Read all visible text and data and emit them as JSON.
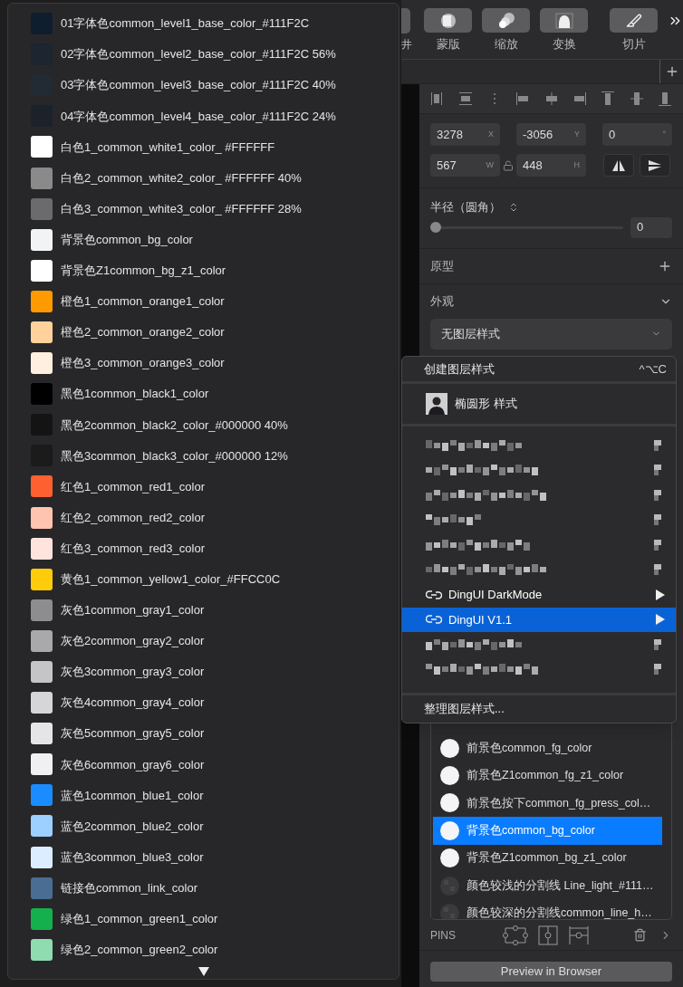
{
  "color_list": {
    "items": [
      {
        "label": "01字体色common_level1_base_color_#111F2C",
        "color": "#0f1e2e"
      },
      {
        "label": "02字体色common_level2_base_color_#111F2C 56%",
        "color": "#1c2530"
      },
      {
        "label": "03字体色common_level3_base_color_#111F2C 40%",
        "color": "#222a33"
      },
      {
        "label": "04字体色common_level4_base_color_#111F2C 24%",
        "color": "#1c222a"
      },
      {
        "label": "白色1_common_white1_color_ #FFFFFF",
        "color": "#ffffff"
      },
      {
        "label": "白色2_common_white2_color_ #FFFFFF 40%",
        "color": "#8a8a8a"
      },
      {
        "label": "白色3_common_white3_color_ #FFFFFF 28%",
        "color": "#6b6b6d"
      },
      {
        "label": "背景色common_bg_color",
        "color": "#f2f3f5"
      },
      {
        "label": "背景色Z1common_bg_z1_color",
        "color": "#ffffff"
      },
      {
        "label": "橙色1_common_orange1_color",
        "color": "#ff9a00"
      },
      {
        "label": "橙色2_common_orange2_color",
        "color": "#ffd29b"
      },
      {
        "label": "橙色3_common_orange3_color",
        "color": "#ffefe0"
      },
      {
        "label": "黑色1common_black1_color",
        "color": "#000000"
      },
      {
        "label": "黑色2common_black2_color_#000000 40%",
        "color": "#141414"
      },
      {
        "label": "黑色3common_black3_color_#000000 12%",
        "color": "#1b1b1c"
      },
      {
        "label": "红色1_common_red1_color",
        "color": "#ff6030"
      },
      {
        "label": "红色2_common_red2_color",
        "color": "#ffc4b0"
      },
      {
        "label": "红色3_common_red3_color",
        "color": "#ffe4dd"
      },
      {
        "label": "黄色1_common_yellow1_color_#FFCC0C",
        "color": "#ffcc0c"
      },
      {
        "label": "灰色1common_gray1_color",
        "color": "#8d8d90"
      },
      {
        "label": "灰色2common_gray2_color",
        "color": "#a9a9ac"
      },
      {
        "label": "灰色3common_gray3_color",
        "color": "#c5c5c8"
      },
      {
        "label": "灰色4common_gray4_color",
        "color": "#d6d6d8"
      },
      {
        "label": "灰色5common_gray5_color",
        "color": "#e5e5e7"
      },
      {
        "label": "灰色6common_gray6_color",
        "color": "#f0f0f2"
      },
      {
        "label": "蓝色1common_blue1_color",
        "color": "#1a8cff"
      },
      {
        "label": "蓝色2common_blue2_color",
        "color": "#9dcfff"
      },
      {
        "label": "蓝色3common_blue3_color",
        "color": "#dcedff"
      },
      {
        "label": "链接色common_link_color",
        "color": "#4a6d93"
      },
      {
        "label": "绿色1_common_green1_color",
        "color": "#14b04e"
      },
      {
        "label": "绿色2_common_green2_color",
        "color": "#8fdcb0"
      }
    ]
  },
  "toolbar": {
    "buttons": [
      {
        "label": "井",
        "kind": "cut"
      },
      {
        "label": "蒙版",
        "kind": "mask"
      },
      {
        "label": "缩放",
        "kind": "scale"
      },
      {
        "label": "变换",
        "kind": "transform"
      },
      {
        "label": "切片",
        "kind": "slice"
      }
    ]
  },
  "inspector": {
    "position": [
      {
        "value": "3278",
        "unit": "X"
      },
      {
        "value": "-3056",
        "unit": "Y"
      },
      {
        "value": "0",
        "unit": "°"
      }
    ],
    "size": [
      {
        "value": "567",
        "unit": "W"
      },
      {
        "value": "448",
        "unit": "H"
      }
    ],
    "locked": false,
    "radius": {
      "label": "半径（圆角）",
      "level": 0,
      "value": "0"
    },
    "prototype": "原型",
    "appearance": "外观",
    "style_select": "无图层样式"
  },
  "style_menu": {
    "header": {
      "label": "创建图层样式",
      "shortcut": "^⌥C"
    },
    "style_item": "椭圆形 样式",
    "items": [
      {
        "kind": "blurred",
        "selected": false
      },
      {
        "kind": "blurred",
        "selected": false
      },
      {
        "kind": "blurred",
        "selected": false
      },
      {
        "kind": "blurred",
        "selected": false
      },
      {
        "kind": "blurred",
        "selected": false
      },
      {
        "kind": "blurred",
        "selected": false
      },
      {
        "kind": "library",
        "label": "DingUI DarkMode",
        "selected": false
      },
      {
        "kind": "library",
        "label": "DingUI V1.1",
        "selected": true
      },
      {
        "kind": "blurred",
        "selected": false
      },
      {
        "kind": "blurred",
        "selected": false
      }
    ],
    "footer": "整理图层样式..."
  },
  "style_list": {
    "items": [
      {
        "label": "前景色common_fg_color",
        "kind": "solid",
        "selected": false
      },
      {
        "label": "前景色Z1common_fg_z1_color",
        "kind": "solid",
        "selected": false
      },
      {
        "label": "前景色按下common_fg_press_col…",
        "kind": "solid",
        "selected": false
      },
      {
        "label": "背景色common_bg_color",
        "kind": "solid",
        "selected": true
      },
      {
        "label": "背景色Z1common_bg_z1_color",
        "kind": "solid",
        "selected": false
      },
      {
        "label": "颜色较浅的分割线 Line_light_#111…",
        "kind": "checker",
        "selected": false
      },
      {
        "label": "颜色较深的分割线common_line_h…",
        "kind": "checker",
        "selected": false
      }
    ]
  },
  "pins": {
    "label": "PINS"
  },
  "preview_button": "Preview in Browser"
}
